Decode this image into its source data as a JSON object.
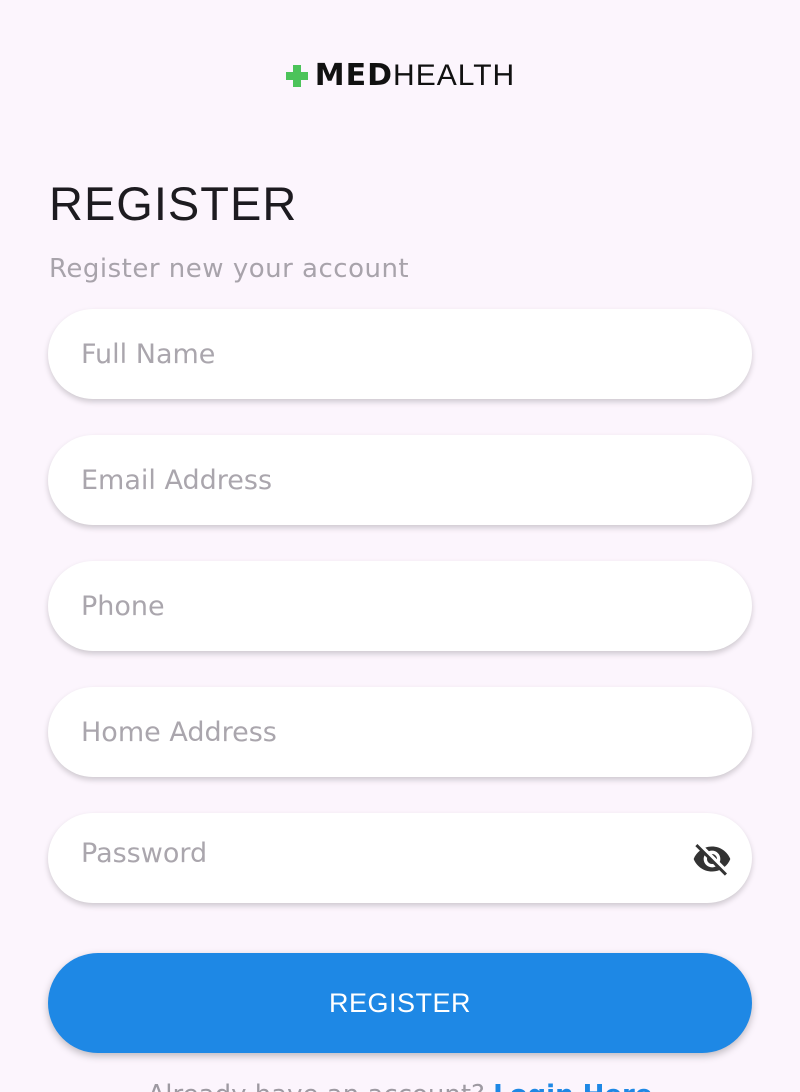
{
  "brand": {
    "name_bold": "MED",
    "name_light": "HEALTH",
    "cross_color": "#4cc35a",
    "icon": "plus-cross-icon"
  },
  "register": {
    "title": "REGISTER",
    "subtitle": "Register new your account"
  },
  "form": {
    "full_name_placeholder": "Full Name",
    "email_placeholder": "Email Address",
    "phone_placeholder": "Phone",
    "home_address_placeholder": "Home Address",
    "password_placeholder": "Password",
    "password_toggle_icon": "eye-off-icon"
  },
  "actions": {
    "register_label": "REGISTER"
  },
  "footer": {
    "prompt": "Already have an account?",
    "login_link": "Login Here"
  },
  "colors": {
    "background": "#fcf5fd",
    "primary": "#1e88e5",
    "placeholder": "#aaa6ad"
  }
}
